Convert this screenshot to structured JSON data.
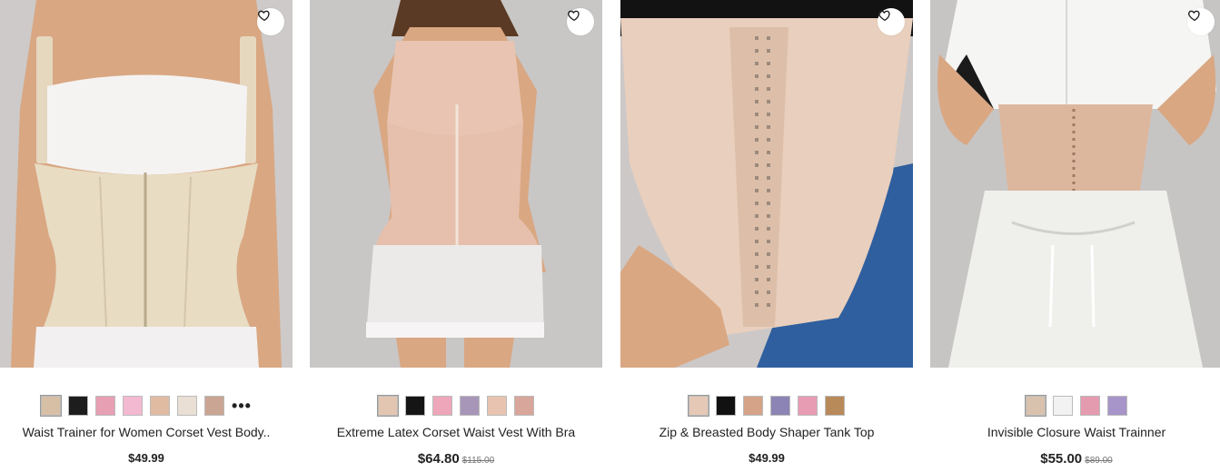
{
  "products": [
    {
      "title": "Waist Trainer for Women Corset Vest Body..",
      "price": "$49.99",
      "original_price": "",
      "wishlist_icon": "heart-outline-icon",
      "swatches": [
        "#d7bfa6",
        "#1d1d1d",
        "#e79fb4",
        "#f3b9d0",
        "#e0bba2",
        "#eadfd4",
        "#caa594"
      ],
      "more_label": "•••"
    },
    {
      "title": "Extreme Latex Corset Waist Vest With Bra",
      "price": "$64.80",
      "original_price": "$115.00",
      "wishlist_icon": "heart-outline-icon",
      "swatches": [
        "#e3c6b2",
        "#151515",
        "#eda6ba",
        "#a896b8",
        "#e8c4b0",
        "#d8a69a"
      ]
    },
    {
      "title": "Zip & Breasted Body Shaper Tank Top",
      "price": "$49.99",
      "original_price": "",
      "wishlist_icon": "heart-outline-icon",
      "swatches": [
        "#e5c8b6",
        "#111111",
        "#d4a388",
        "#8c84b4",
        "#e89cb4",
        "#b88a5a"
      ]
    },
    {
      "title": "Invisible Closure Waist Trainner",
      "price": "$55.00",
      "original_price": "$89.00",
      "wishlist_icon": "heart-outline-icon",
      "swatches": [
        "#d8c2ae",
        "#f2f2f2",
        "#e49bb0",
        "#a794c9"
      ]
    }
  ]
}
